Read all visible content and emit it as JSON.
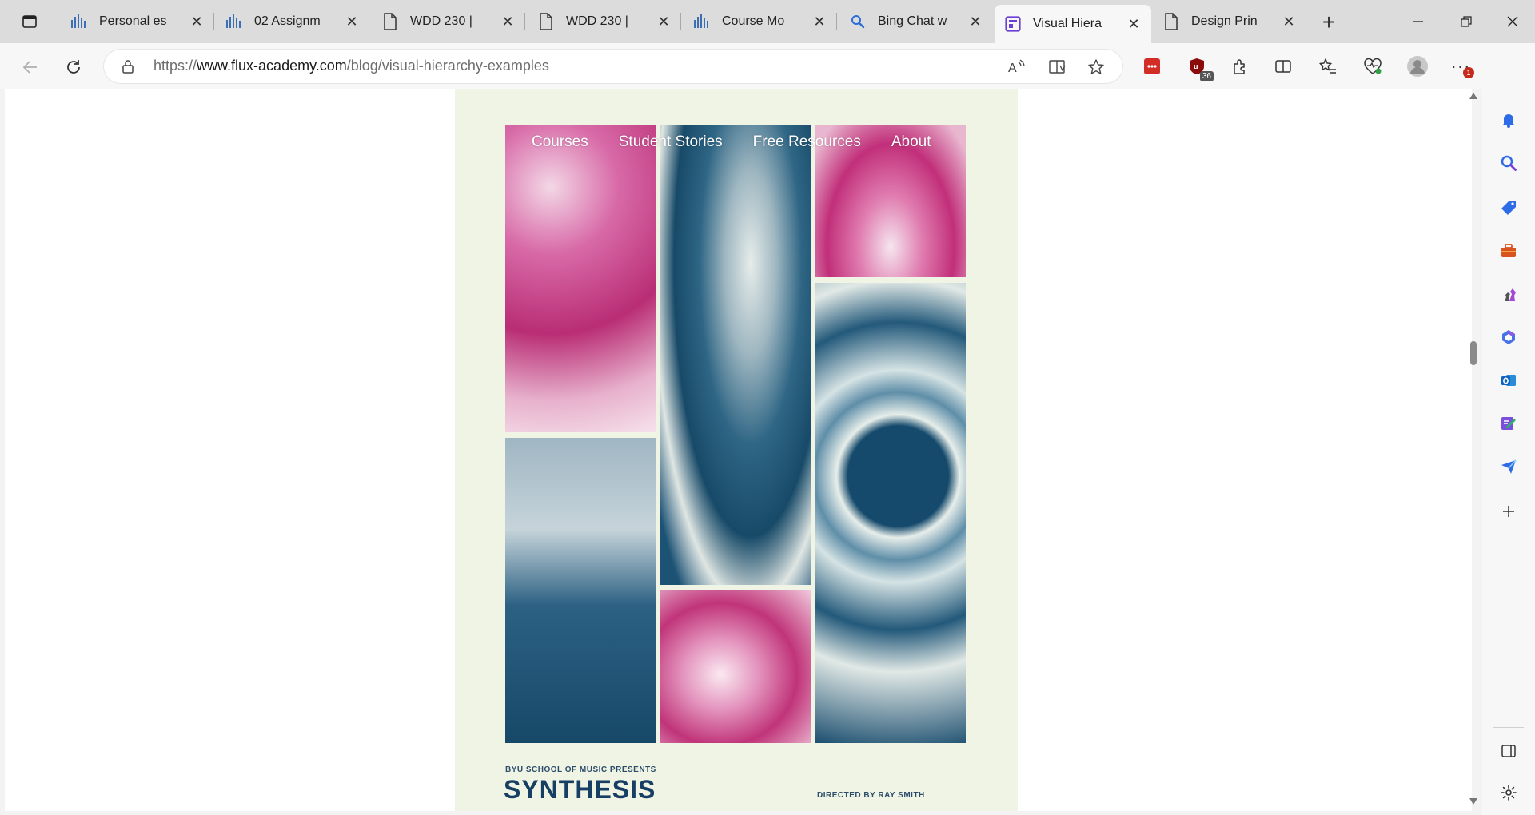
{
  "browser": {
    "tabs": [
      {
        "title": "Personal es",
        "icon": "canvas-icon"
      },
      {
        "title": "02 Assignm",
        "icon": "canvas-icon"
      },
      {
        "title": "WDD 230 |",
        "icon": "page-icon"
      },
      {
        "title": "WDD 230 |",
        "icon": "page-icon"
      },
      {
        "title": "Course Mo",
        "icon": "canvas-icon"
      },
      {
        "title": "Bing Chat w",
        "icon": "bing-search-icon"
      },
      {
        "title": "Visual Hiera",
        "icon": "flux-icon",
        "active": true
      },
      {
        "title": "Design Prin",
        "icon": "page-icon"
      }
    ],
    "address": {
      "scheme": "https://",
      "host": "www.flux-academy.com",
      "path": "/blog/visual-hierarchy-examples"
    },
    "extension_badge": "36",
    "notification_badge": "1"
  },
  "page": {
    "nav": [
      "Courses",
      "Student Stories",
      "Free Resources",
      "About"
    ],
    "poster": {
      "presents": "BYU SCHOOL OF MUSIC PRESENTS",
      "title": "SYNTHESIS",
      "director": "DIRECTED BY RAY SMITH"
    }
  },
  "colors": {
    "magenta": "#c2317d",
    "teal": "#1b5677",
    "poster_bg": "#f0f4e4",
    "tab_strip": "#dcdcdc"
  }
}
